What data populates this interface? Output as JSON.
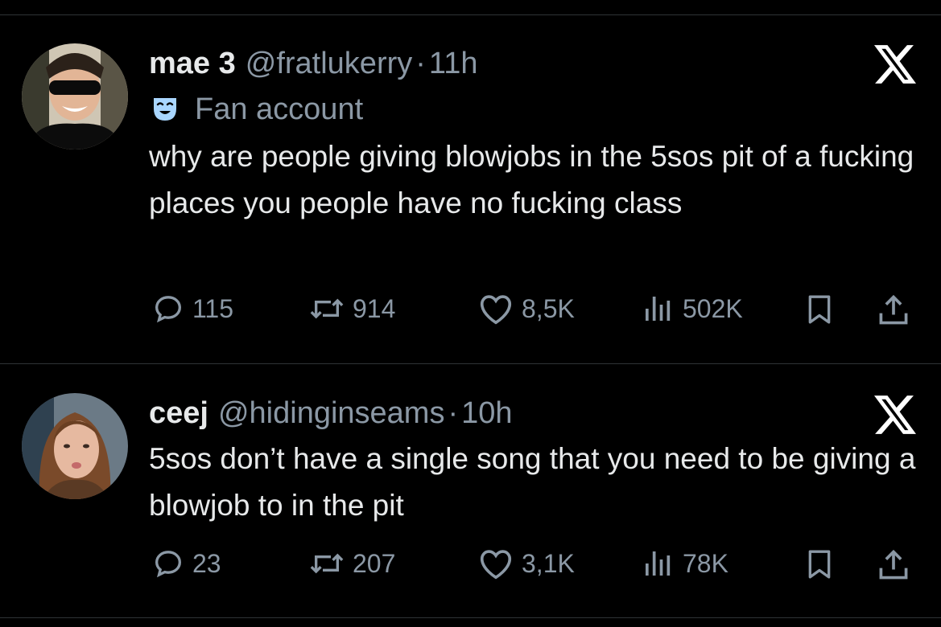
{
  "tweets": [
    {
      "display_name": "mae 3",
      "handle": "@fratlukerry",
      "separator": "·",
      "time": "11h",
      "badge_icon": "theater-mask-icon",
      "badge_label": "Fan account",
      "text": "why are people giving blowjobs in the 5sos pit of a fucking places you people have no fucking class",
      "replies": "115",
      "reposts": "914",
      "likes": "8,5K",
      "views": "502K"
    },
    {
      "display_name": "ceej",
      "handle": "@hidinginseams",
      "separator": "·",
      "time": "10h",
      "text": "5sos don’t have a single song that you need to be giving a blowjob to in the pit",
      "replies": "23",
      "reposts": "207",
      "likes": "3,1K",
      "views": "78K"
    }
  ],
  "colors": {
    "background": "#000000",
    "primary_text": "#e7e9ea",
    "secondary_text": "#8b98a5",
    "divider": "#2f3336",
    "badge_icon": "#a9d6ff"
  },
  "icons": [
    "x-logo-icon",
    "reply-icon",
    "repost-icon",
    "like-icon",
    "views-icon",
    "bookmark-icon",
    "share-icon"
  ]
}
